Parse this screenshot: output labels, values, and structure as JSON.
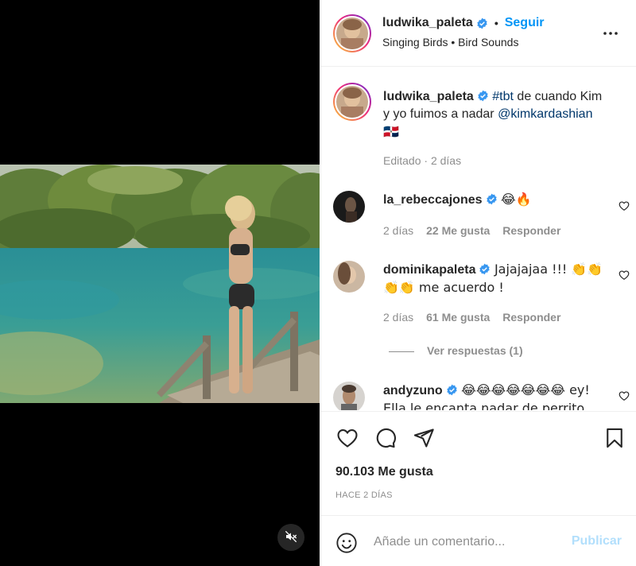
{
  "post": {
    "author": "ludwika_paleta",
    "follow_label": "Seguir",
    "separator": "•",
    "audio": "Singing Birds • Bird Sounds",
    "more_icon": "more-horizontal-icon"
  },
  "caption": {
    "author": "ludwika_paleta",
    "hashtag": "#tbt",
    "text_1": " de cuando Kim y yo fuimos a nadar ",
    "mention": "@kimkardashian",
    "flag": "🇩🇴",
    "edited": "Editado",
    "dot": "·",
    "time": "2 días"
  },
  "comments": [
    {
      "user": "la_rebeccajones",
      "text": "😂🔥",
      "time": "2 días",
      "likes": "22 Me gusta",
      "reply": "Responder"
    },
    {
      "user": "dominikapaleta",
      "text": "Jajajajaa !!! 👏👏👏👏 me acuerdo !",
      "time": "2 días",
      "likes": "61 Me gusta",
      "reply": "Responder",
      "view_replies": "Ver respuestas (1)"
    },
    {
      "user": "andyzuno",
      "text": "😂😂😂😂😂😂😂 ey! Ella le encanta nadar de perrito"
    }
  ],
  "stats": {
    "likes": "90.103 Me gusta",
    "posted": "HACE 2 DÍAS"
  },
  "composer": {
    "placeholder": "Añade un comentario...",
    "publish": "Publicar"
  },
  "colors": {
    "accent": "#0095f6",
    "publish_disabled": "#b2dffc",
    "link": "#00376b",
    "muted": "#8e8e8e"
  }
}
